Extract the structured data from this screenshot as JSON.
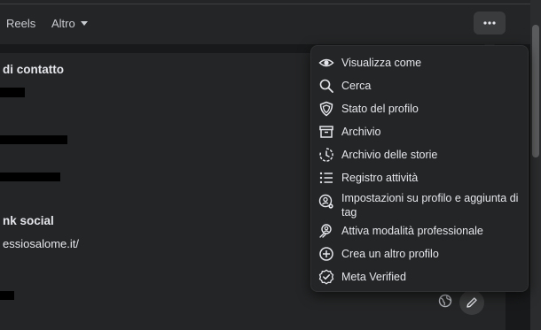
{
  "nav": {
    "tabs": [
      {
        "label": "Reels"
      },
      {
        "label": "Altro"
      }
    ],
    "more_button_label": "···"
  },
  "profile": {
    "contact_section_title": "di contatto",
    "social_section_title": "nk social",
    "website_text": "essiosalome.it/"
  },
  "menu": {
    "items": [
      {
        "label": "Visualizza come",
        "icon": "eye-icon"
      },
      {
        "label": "Cerca",
        "icon": "search-icon"
      },
      {
        "label": "Stato del profilo",
        "icon": "shield-icon"
      },
      {
        "label": "Archivio",
        "icon": "archive-icon"
      },
      {
        "label": "Archivio delle storie",
        "icon": "history-icon"
      },
      {
        "label": "Registro attività",
        "icon": "list-icon"
      },
      {
        "label": "Impostazioni su profilo e aggiunta di tag",
        "icon": "profile-settings-icon"
      },
      {
        "label": "Attiva modalità professionale",
        "icon": "professional-icon"
      },
      {
        "label": "Crea un altro profilo",
        "icon": "plus-circle-icon"
      },
      {
        "label": "Meta Verified",
        "icon": "verified-badge-icon"
      }
    ]
  },
  "colors": {
    "background": "#18191a",
    "surface": "#242526",
    "text": "#e4e6eb",
    "button": "#3a3b3c"
  }
}
